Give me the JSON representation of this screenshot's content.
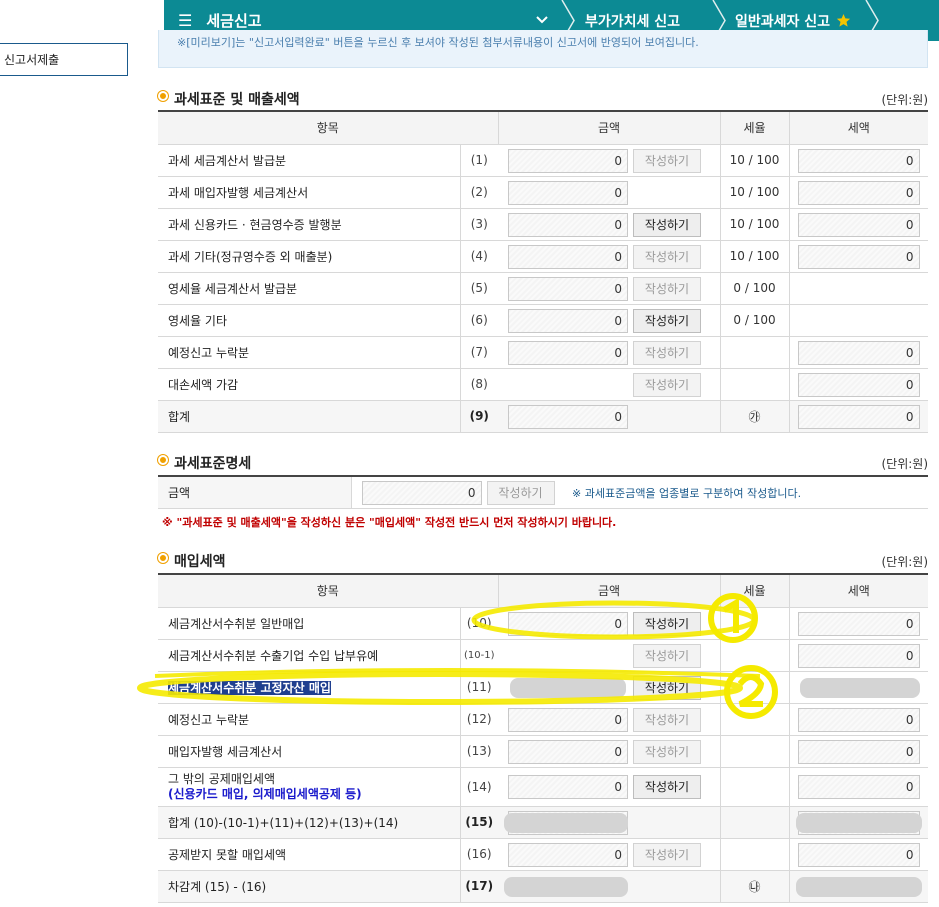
{
  "topbar": {
    "menu_label": "세금신고",
    "crumbs": [
      "부가가치세 신고",
      "일반과세자 신고"
    ],
    "colors": {
      "bar": "#0c8a94",
      "star": "#f5c400"
    }
  },
  "sidebar": {
    "item_label": "신고서제출"
  },
  "notice": {
    "text": "※[미리보기]는 \"신고서입력완료\" 버튼을 누르신 후 보셔야 작성된 첨부서류내용이 신고서에 반영되어 보여집니다."
  },
  "unit_label": "(단위:원)",
  "sales": {
    "title": "과세표준 및 매출세액",
    "headers": [
      "항목",
      "금액",
      "세율",
      "세액"
    ],
    "rows": [
      {
        "label": "과세 세금계산서 발급분",
        "num": "(1)",
        "amount": "0",
        "button": "작성하기",
        "rate": "10 / 100",
        "tax": "0"
      },
      {
        "label": "과세 매입자발행 세금계산서",
        "num": "(2)",
        "amount": "0",
        "button": "",
        "rate": "10 / 100",
        "tax": "0"
      },
      {
        "label": "과세 신용카드 · 현금영수증 발행분",
        "num": "(3)",
        "amount": "0",
        "button": "작성하기",
        "rate": "10 / 100",
        "tax": "0"
      },
      {
        "label": "과세 기타(정규영수증 외 매출분)",
        "num": "(4)",
        "amount": "0",
        "button": "작성하기",
        "rate": "10 / 100",
        "tax": "0"
      },
      {
        "label": "영세율 세금계산서 발급분",
        "num": "(5)",
        "amount": "0",
        "button": "작성하기",
        "rate": "0 / 100",
        "tax": ""
      },
      {
        "label": "영세율 기타",
        "num": "(6)",
        "amount": "0",
        "button": "작성하기",
        "rate": "0 / 100",
        "tax": ""
      },
      {
        "label": "예정신고 누락분",
        "num": "(7)",
        "amount": "0",
        "button": "작성하기",
        "rate": "",
        "tax": "0"
      },
      {
        "label": "대손세액 가감",
        "num": "(8)",
        "amount": "",
        "button": "작성하기",
        "rate": "",
        "tax": "0"
      },
      {
        "label": "합계",
        "num": "(9)",
        "amount": "0",
        "button": "",
        "rate": "㉮",
        "tax": "0"
      }
    ]
  },
  "base": {
    "title": "과세표준명세",
    "label": "금액",
    "amount": "0",
    "button": "작성하기",
    "hint": "※ 과세표준금액을 업종별로 구분하여 작성합니다."
  },
  "warning": "※ \"과세표준 및 매출세액\"을 작성하신 분은 \"매입세액\" 작성전 반드시 먼저 작성하시기 바랍니다.",
  "purchase": {
    "title": "매입세액",
    "headers": [
      "항목",
      "금액",
      "세율",
      "세액"
    ],
    "rows": [
      {
        "label": "세금계산서수취분 일반매입",
        "num": "(10)",
        "amount": "0",
        "button": "작성하기",
        "tax": "0"
      },
      {
        "label": "세금계산서수취분 수출기업 수입 납부유예",
        "num": "(10-1)",
        "amount": "",
        "button": "작성하기",
        "tax": "0"
      },
      {
        "label": "세금계산서수취분 고정자산 매입",
        "num": "(11)",
        "amount": "",
        "button": "작성하기",
        "tax": ""
      },
      {
        "label": "예정신고 누락분",
        "num": "(12)",
        "amount": "0",
        "button": "작성하기",
        "tax": "0"
      },
      {
        "label": "매입자발행 세금계산서",
        "num": "(13)",
        "amount": "0",
        "button": "작성하기",
        "tax": "0"
      },
      {
        "label": "그 밖의 공제매입세액",
        "sublabel": "(신용카드 매입, 의제매입세액공제 등)",
        "num": "(14)",
        "amount": "0",
        "button": "작성하기",
        "tax": "0"
      },
      {
        "label": "합계 (10)-(10-1)+(11)+(12)+(13)+(14)",
        "num": "(15)",
        "amount": "",
        "button": "",
        "tax": ""
      },
      {
        "label": "공제받지 못할 매입세액",
        "num": "(16)",
        "amount": "0",
        "button": "작성하기",
        "tax": "0"
      },
      {
        "label": "차감계 (15) - (16)",
        "num": "(17)",
        "amount": "",
        "button": "",
        "rate": "㉯",
        "tax": ""
      }
    ]
  },
  "annotations": {
    "mark1": "①",
    "mark2": "②",
    "color": "#f5ea00"
  }
}
